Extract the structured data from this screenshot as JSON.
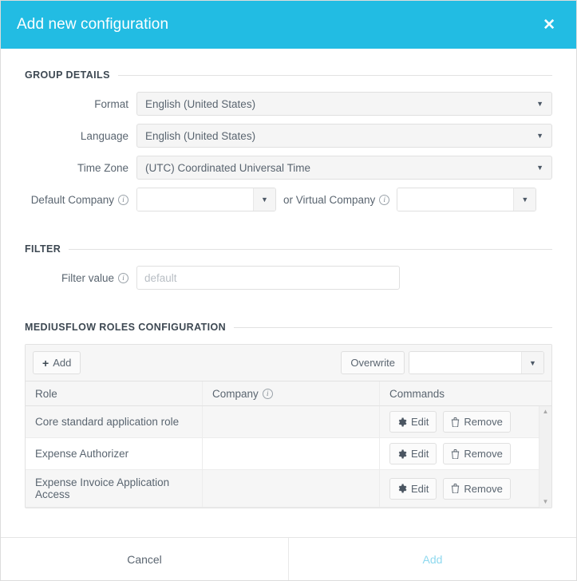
{
  "dialog": {
    "title": "Add new configuration",
    "close_label": "✕",
    "accent_color": "#22bce3",
    "link_color": "#8fd9ef"
  },
  "sections": {
    "group_details": {
      "title": "GROUP DETAILS"
    },
    "filter": {
      "title": "FILTER"
    },
    "roles": {
      "title": "MEDIUSFLOW ROLES CONFIGURATION"
    }
  },
  "fields": {
    "format": {
      "label": "Format",
      "value": "English (United States)"
    },
    "language": {
      "label": "Language",
      "value": "English (United States)"
    },
    "timezone": {
      "label": "Time Zone",
      "value": "(UTC) Coordinated Universal Time"
    },
    "default_company": {
      "label": "Default Company",
      "value": "",
      "info": "i"
    },
    "or_virtual_company": {
      "label": "or Virtual Company",
      "value": "",
      "info": "i"
    },
    "filter_value": {
      "label": "Filter value",
      "value": "",
      "placeholder": "default",
      "info": "i"
    }
  },
  "toolbar": {
    "add_label": "Add",
    "add_plus": "+",
    "overwrite_label": "Overwrite",
    "overwrite_value": ""
  },
  "table": {
    "columns": [
      {
        "label": "Role"
      },
      {
        "label": "Company",
        "info": "i"
      },
      {
        "label": "Commands"
      }
    ],
    "rows": [
      {
        "role": "Core standard application role",
        "company": "",
        "edit_label": "Edit",
        "remove_label": "Remove"
      },
      {
        "role": "Expense Authorizer",
        "company": "",
        "edit_label": "Edit",
        "remove_label": "Remove"
      },
      {
        "role": "Expense Invoice Application Access",
        "company": "",
        "edit_label": "Edit",
        "remove_label": "Remove"
      }
    ],
    "scroll_up": "▲",
    "scroll_down": "▼"
  },
  "footer": {
    "cancel_label": "Cancel",
    "add_label": "Add"
  },
  "icons": {
    "caret_down": "▼"
  }
}
